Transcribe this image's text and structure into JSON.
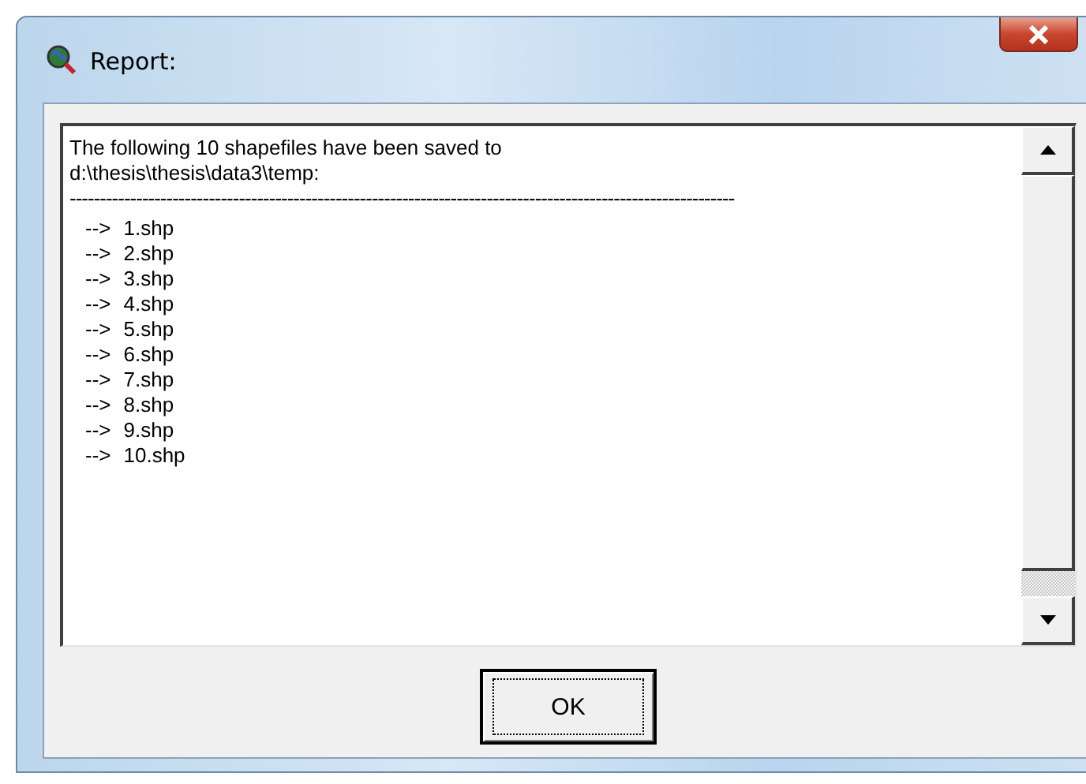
{
  "window": {
    "title": "Report:"
  },
  "report": {
    "intro": "The following 10 shapefiles have been saved to",
    "path": "d:\\thesis\\thesis\\data3\\temp:",
    "separator": "--------------------------------------------------------------------------------------------------------------",
    "files": [
      {
        "marker": "-->",
        "name": "1.shp"
      },
      {
        "marker": "-->",
        "name": "2.shp"
      },
      {
        "marker": "-->",
        "name": "3.shp"
      },
      {
        "marker": "-->",
        "name": "4.shp"
      },
      {
        "marker": "-->",
        "name": "5.shp"
      },
      {
        "marker": "-->",
        "name": "6.shp"
      },
      {
        "marker": "-->",
        "name": "7.shp"
      },
      {
        "marker": "-->",
        "name": "8.shp"
      },
      {
        "marker": "-->",
        "name": "9.shp"
      },
      {
        "marker": "-->",
        "name": "10.shp"
      }
    ]
  },
  "buttons": [
    {
      "label": "OK"
    }
  ]
}
